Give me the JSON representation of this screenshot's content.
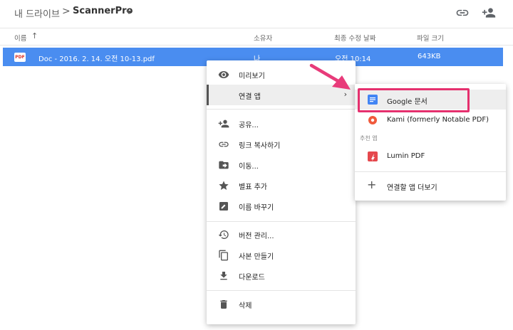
{
  "breadcrumb": {
    "root": "내 드라이브",
    "separator": ">",
    "folder": "ScannerPro"
  },
  "header_icons": [
    "link-icon",
    "add-person-icon"
  ],
  "columns": {
    "name": "이름",
    "owner": "소유자",
    "modified": "최종 수정 날짜",
    "size": "파일 크기"
  },
  "file": {
    "badge": "PDF",
    "name": "Doc - 2016. 2. 14. 오전 10-13.pdf",
    "owner": "나",
    "modified": "오전 10:14",
    "size": "643KB"
  },
  "context_menu": {
    "items": [
      {
        "label": "미리보기",
        "icon": "eye-icon"
      },
      {
        "label": "연결 앱",
        "icon": "open-with-icon"
      },
      {
        "label": "공유...",
        "icon": "add-person-icon"
      },
      {
        "label": "링크 복사하기",
        "icon": "link-icon"
      },
      {
        "label": "이동...",
        "icon": "folder-move-icon"
      },
      {
        "label": "별표 추가",
        "icon": "star-icon"
      },
      {
        "label": "이름 바꾸기",
        "icon": "edit-icon"
      },
      {
        "label": "버전 관리...",
        "icon": "history-icon"
      },
      {
        "label": "사본 만들기",
        "icon": "copy-icon"
      },
      {
        "label": "다운로드",
        "icon": "download-icon"
      },
      {
        "label": "삭제",
        "icon": "trash-icon"
      }
    ]
  },
  "submenu": {
    "apps": [
      {
        "label": "Google 문서",
        "icon": "google-docs-icon",
        "color": "#4285f4"
      },
      {
        "label": "Kami (formerly Notable PDF)",
        "icon": "kami-icon",
        "color": "#f05a3c"
      }
    ],
    "recommended_label": "추천 앱",
    "recommended": [
      {
        "label": "Lumin PDF",
        "icon": "lumin-pdf-icon",
        "color": "#e5484d"
      }
    ],
    "more": {
      "label": "연결할 앱 더보기",
      "icon": "plus-icon"
    }
  },
  "colors": {
    "selection": "#4a8df0",
    "highlight": "#e5306e",
    "arrow": "#e83b7a"
  }
}
